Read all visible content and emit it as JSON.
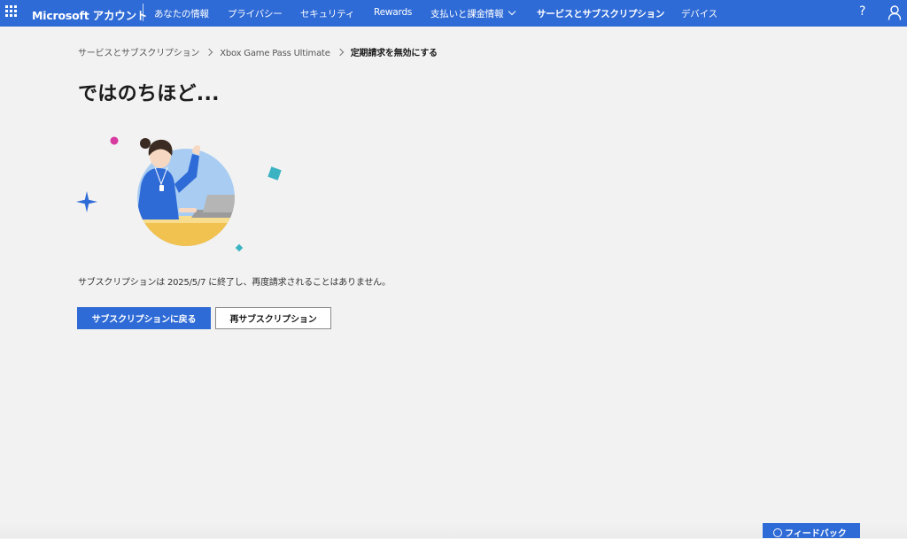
{
  "header": {
    "brand": "Microsoft アカウント",
    "nav": [
      {
        "label": "あなたの情報"
      },
      {
        "label": "プライバシー"
      },
      {
        "label": "セキュリティ"
      },
      {
        "label": "Rewards"
      },
      {
        "label": "支払いと課金情報"
      },
      {
        "label": "サービスとサブスクリプション"
      },
      {
        "label": "デバイス"
      }
    ],
    "help_label": "?",
    "accent_color": "#2f6bd6"
  },
  "breadcrumb": {
    "items": [
      {
        "label": "サービスとサブスクリプション"
      },
      {
        "label": "Xbox Game Pass Ultimate"
      },
      {
        "label": "定期請求を無効にする"
      }
    ]
  },
  "main": {
    "title": "ではのちほど...",
    "message": "サブスクリプションは 2025/5/7 に終了し、再度請求されることはありません。",
    "primary_button": "サブスクリプションに戻る",
    "secondary_button": "再サブスクリプション"
  },
  "feedback": {
    "label": "フィードバック"
  }
}
